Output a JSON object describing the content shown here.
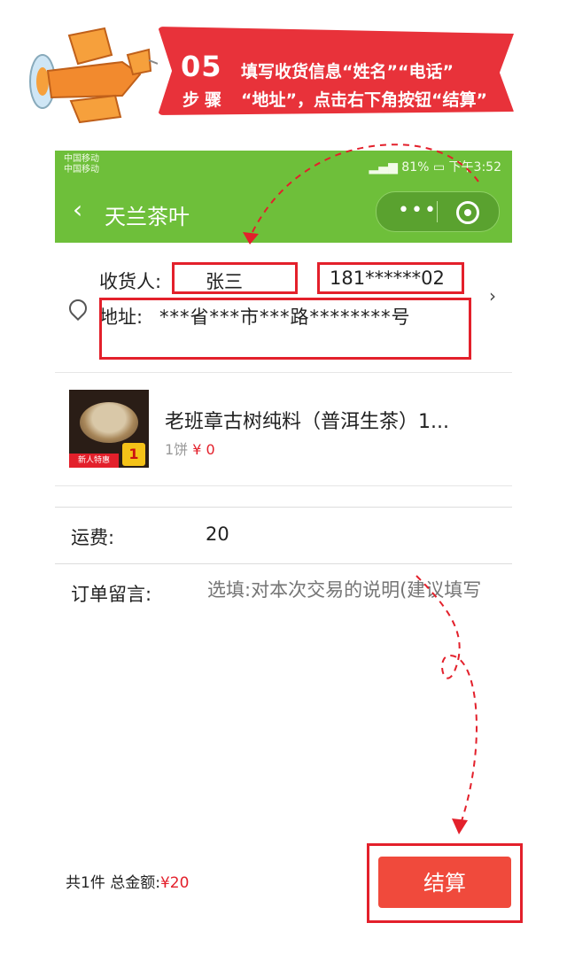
{
  "banner": {
    "step_number": "05",
    "step_word": "步骤",
    "line1": "填写收货信息“姓名”“电话”",
    "line2": "“地址”，点击右下角按钮“结算”"
  },
  "statusbar": {
    "carrier1": "中国移动",
    "carrier2": "中国移动",
    "battery": "81%",
    "time": "下午3:52"
  },
  "header": {
    "title": "天兰茶叶",
    "back_glyph": "‹",
    "more_glyph": "•••"
  },
  "address": {
    "receiver_label": "收货人:",
    "receiver_name": "张三",
    "phone": "181******02",
    "address_label": "地址:",
    "address_value": "***省***市***路********号"
  },
  "product": {
    "title": "老班章古树纯料（普洱生茶）1...",
    "quantity": "1饼",
    "price": "¥ 0",
    "badge_new": "新人特惠",
    "badge_count": "1"
  },
  "shipping": {
    "label": "运费:",
    "value": "20"
  },
  "note": {
    "label": "订单留言:",
    "placeholder": "选填:对本次交易的说明(建议填写"
  },
  "footer": {
    "total_prefix": "共1件 总金额:",
    "total_amount": "¥20",
    "checkout_label": "结算"
  },
  "colors": {
    "accent_green": "#6ebf3a",
    "accent_red": "#e3202b",
    "button_red": "#f04a3c"
  }
}
